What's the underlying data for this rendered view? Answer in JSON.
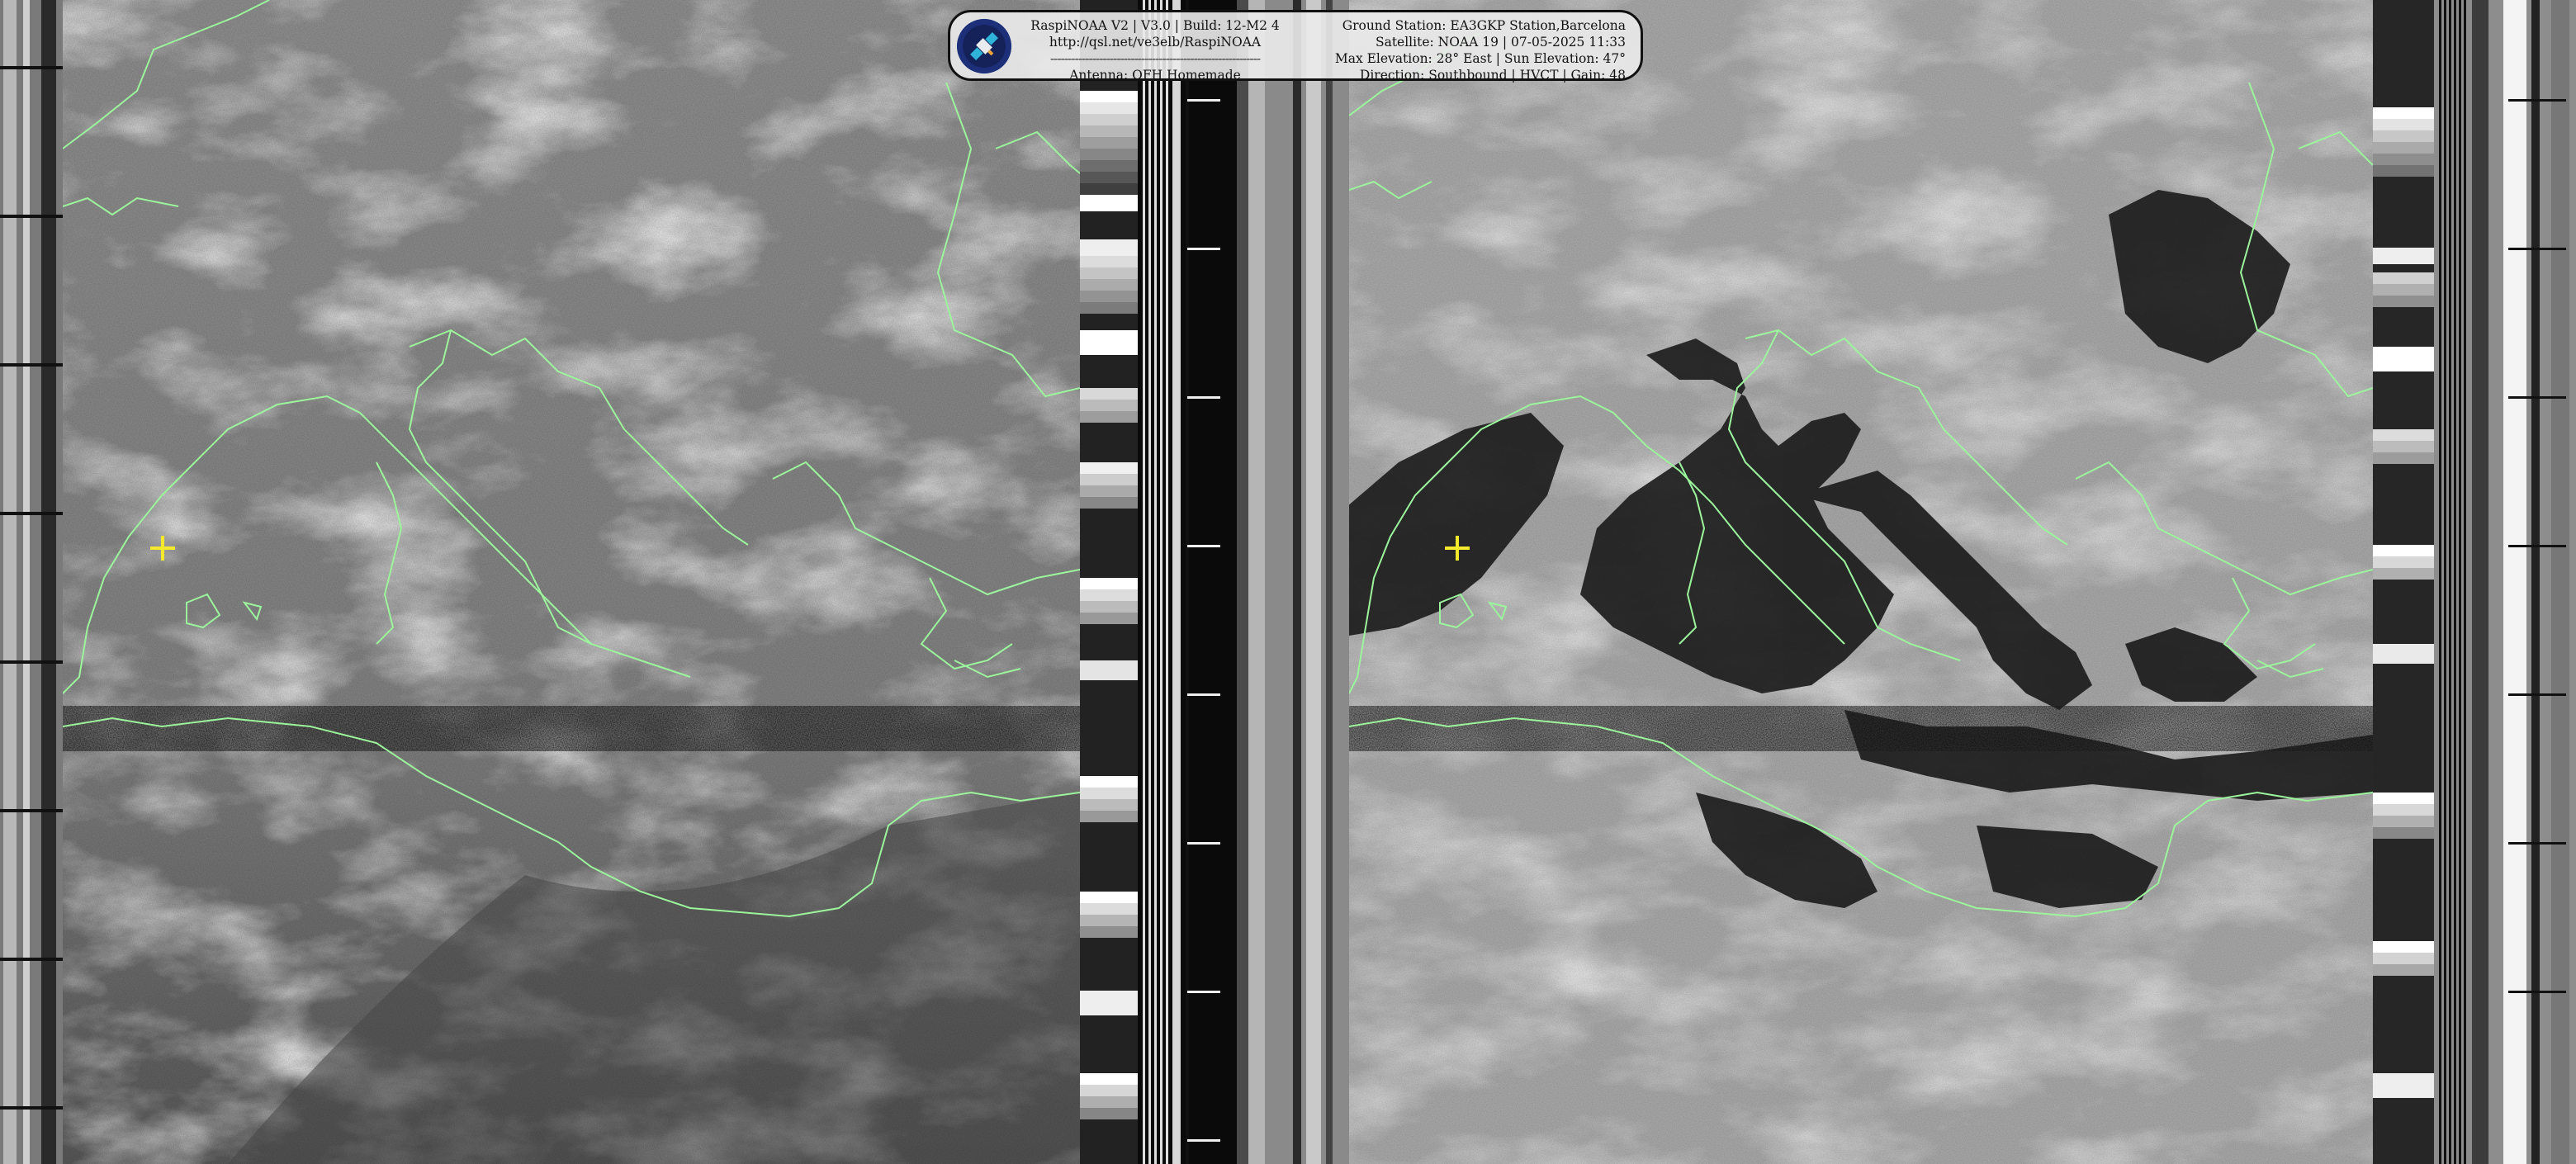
{
  "info": {
    "left_lines": [
      "RaspiNOAA V2 | V3.0 | Build: 12-M2 4",
      "http://qsl.net/ve3elb/RaspiNOAA",
      "------------------------------------------------------------",
      "Antenna: QFH Homemade"
    ],
    "right_lines": [
      "Ground Station: EA3GKP Station,Barcelona",
      "Satellite: NOAA 19 | 07-05-2025 11:33",
      "Max Elevation: 28° East | Sun Elevation: 47°",
      "Direction: Southbound | HVCT | Gain: 48"
    ]
  },
  "logo_icon": "satellite-icon",
  "colors": {
    "coastline": "#9cf59c",
    "marker": "#f2ea2a",
    "info_background": "#ebebeb",
    "logo_background": "#1d2f78"
  }
}
